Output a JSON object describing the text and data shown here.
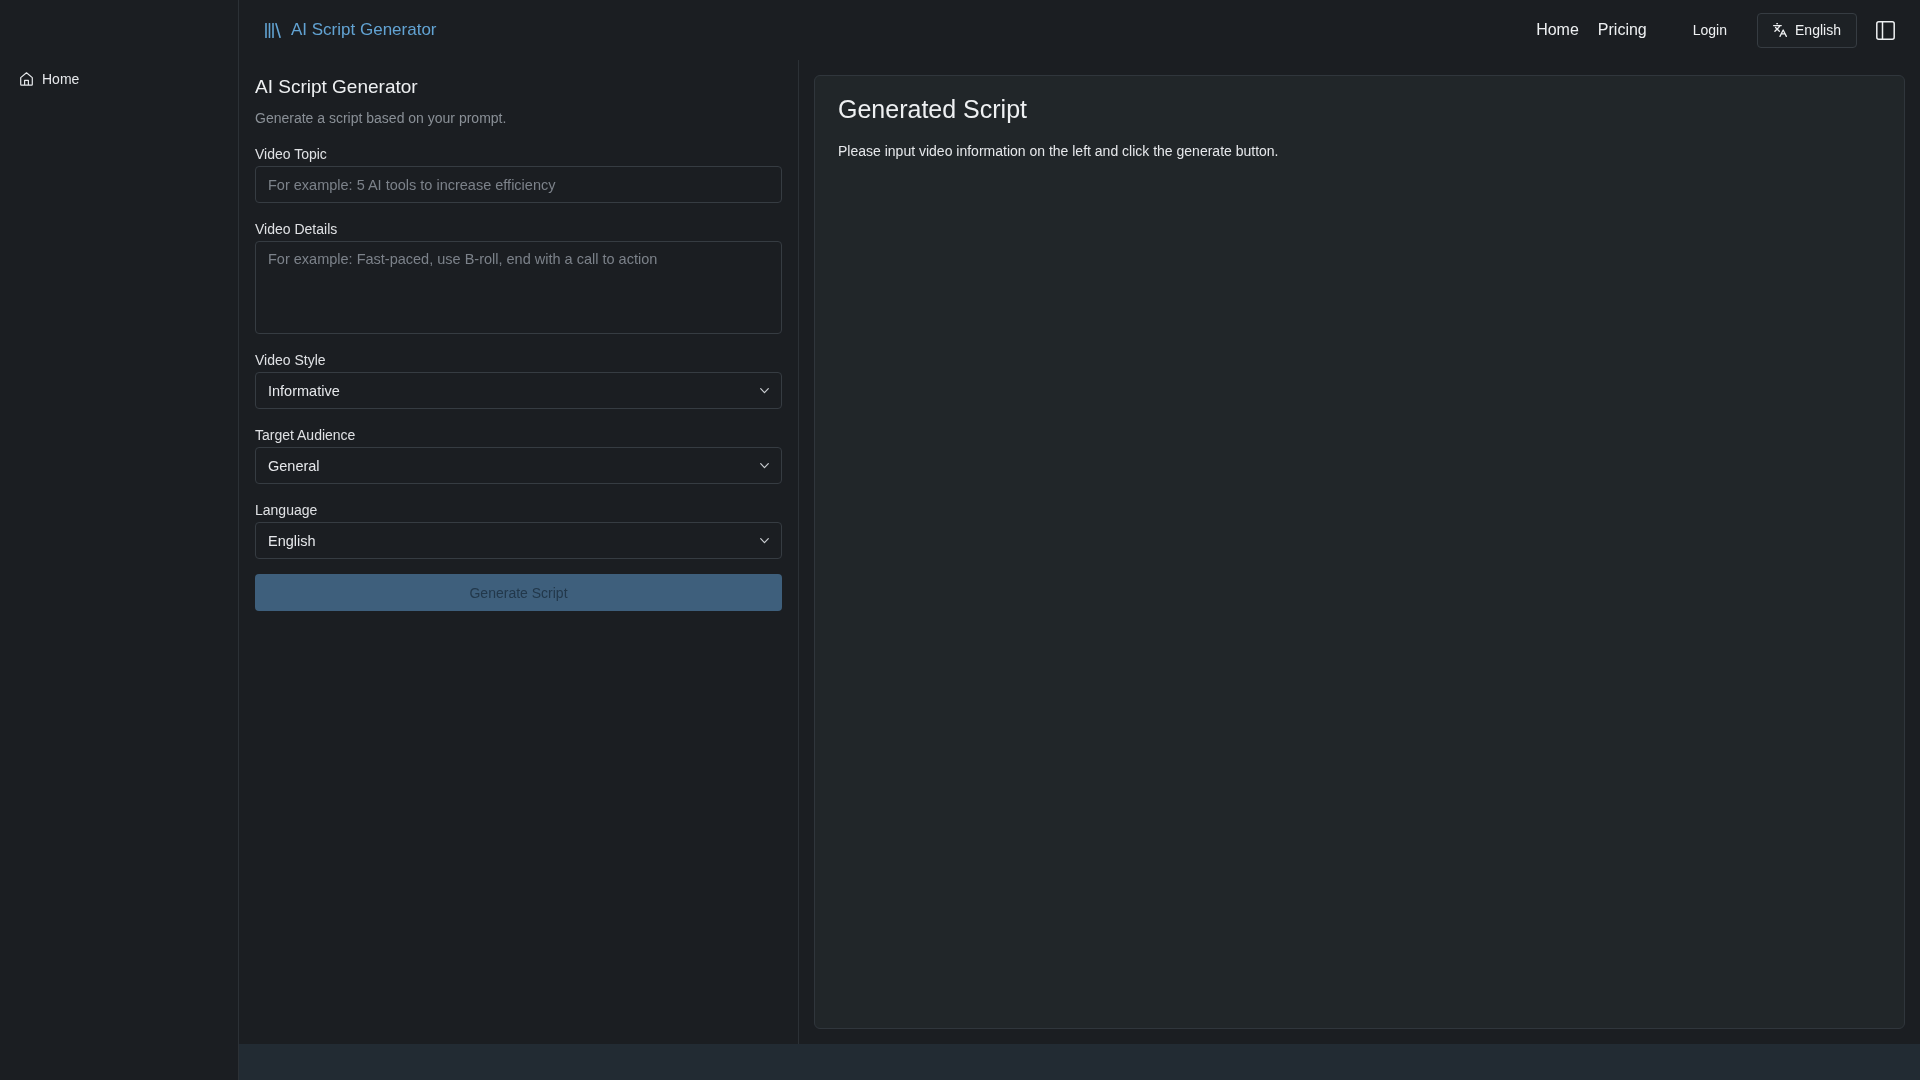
{
  "sidebar": {
    "items": [
      {
        "label": "Home",
        "selected": false
      }
    ]
  },
  "header": {
    "logo_text": "AI Script Generator",
    "nav": [
      {
        "label": "Home"
      },
      {
        "label": "Pricing"
      }
    ],
    "login": "Login",
    "language_button": "English"
  },
  "form": {
    "title": "AI Script Generator",
    "subtitle": "Generate a script based on your prompt.",
    "fields": [
      {
        "kind": "text",
        "label": "Video Topic",
        "placeholder": "For example: 5 AI tools to increase efficiency"
      },
      {
        "kind": "textarea",
        "label": "Video Details",
        "placeholder": "For example: Fast-paced, use B-roll, end with a call to action"
      },
      {
        "kind": "select",
        "label": "Video Style",
        "value": "Informative"
      },
      {
        "kind": "select",
        "label": "Target Audience",
        "value": "General"
      },
      {
        "kind": "select",
        "label": "Language",
        "value": "English"
      }
    ],
    "submit": {
      "label": "Generate Script",
      "disabled": true
    }
  },
  "output": {
    "title": "Generated Script",
    "message": "Please input video information on the left and click the generate button."
  }
}
